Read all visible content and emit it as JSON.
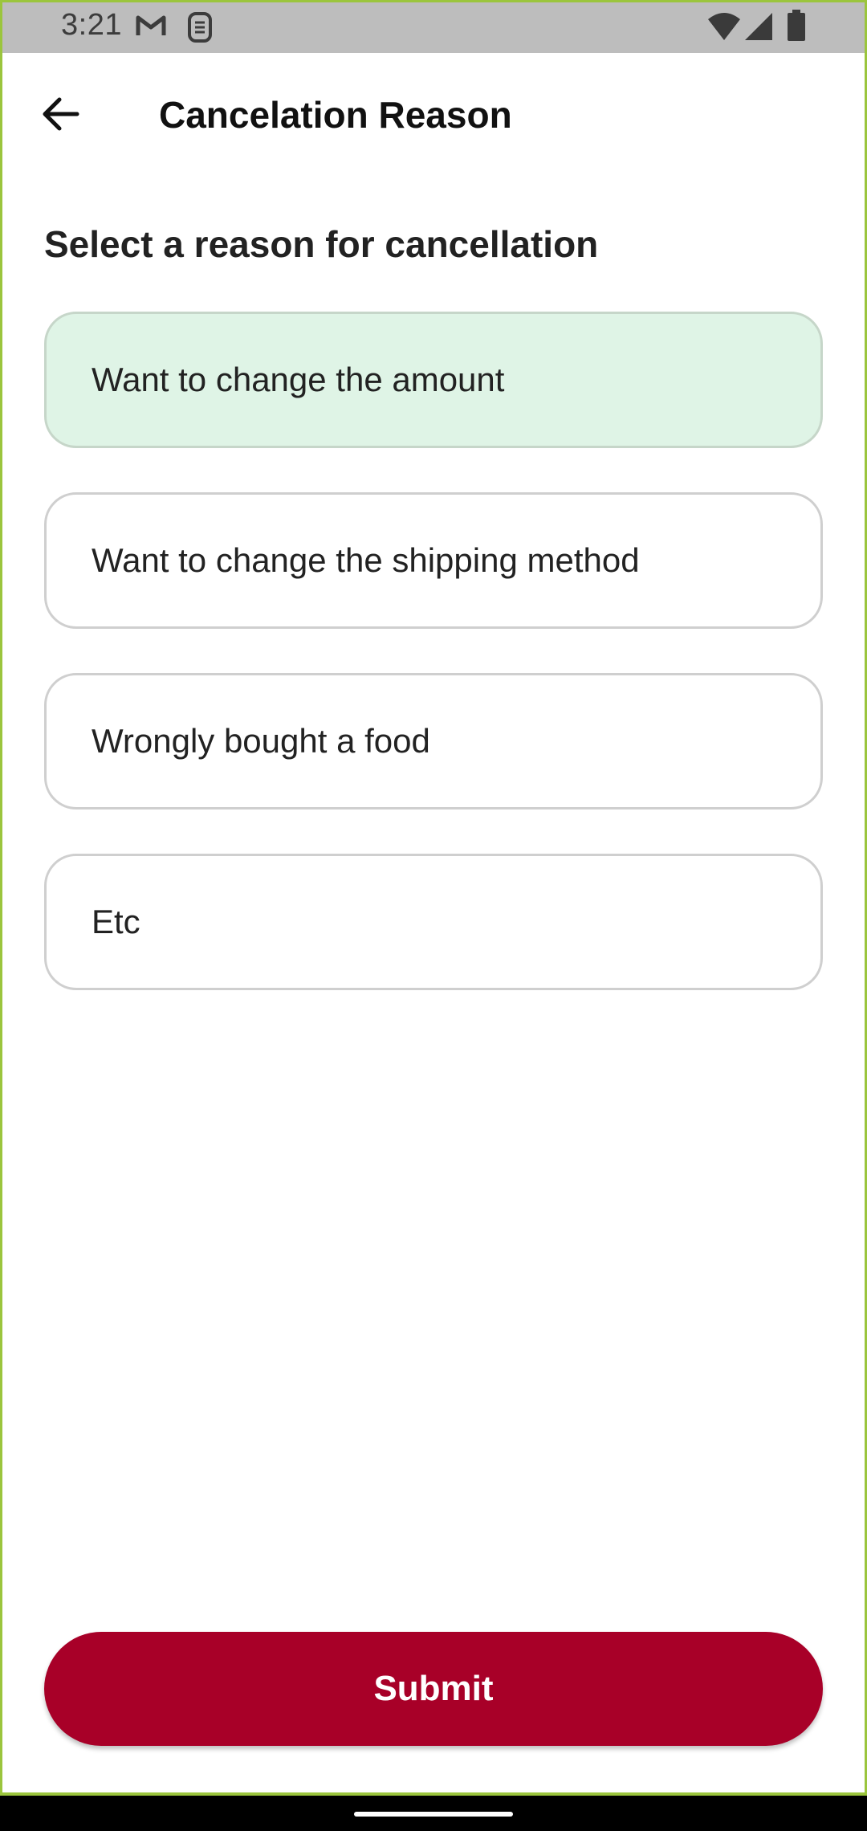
{
  "status_bar": {
    "time": "3:21",
    "left_icons": [
      "gmail-icon",
      "sim-toolkit-icon"
    ],
    "right_icons": [
      "wifi-icon",
      "cell-signal-icon",
      "battery-icon"
    ]
  },
  "app_bar": {
    "back_icon": "arrow-back-icon",
    "title": "Cancelation Reason"
  },
  "section": {
    "title": "Select a reason for cancellation"
  },
  "reasons": [
    {
      "label": "Want to change the amount",
      "selected": true
    },
    {
      "label": "Want to change the shipping method",
      "selected": false
    },
    {
      "label": "Wrongly bought a food",
      "selected": false
    },
    {
      "label": "Etc",
      "selected": false
    }
  ],
  "submit": {
    "label": "Submit"
  },
  "colors": {
    "accent": "#a80028",
    "selected_bg": "#dff4e6",
    "status_bar_bg": "#bdbdbd"
  }
}
